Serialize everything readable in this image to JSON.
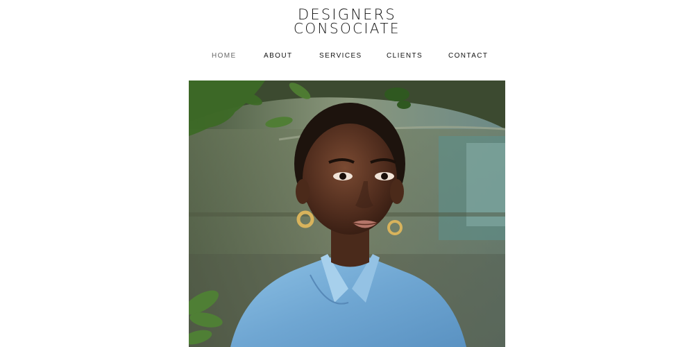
{
  "logo": {
    "line1": "DESIGNERS",
    "line2": "CONSOCIATE"
  },
  "nav": {
    "items": [
      {
        "label": "HOME",
        "active": true
      },
      {
        "label": "ABOUT",
        "active": false
      },
      {
        "label": "SERVICES",
        "active": false
      },
      {
        "label": "CLIENTS",
        "active": false
      },
      {
        "label": "CONTACT",
        "active": false
      }
    ]
  },
  "hero": {
    "image": "portrait-photo",
    "colors": {
      "background_green": "#6d7d62",
      "foliage": "#3f6b2a",
      "skin": "#5a3423",
      "shirt": "#7fb3d9",
      "earring": "#c9a24a"
    }
  }
}
